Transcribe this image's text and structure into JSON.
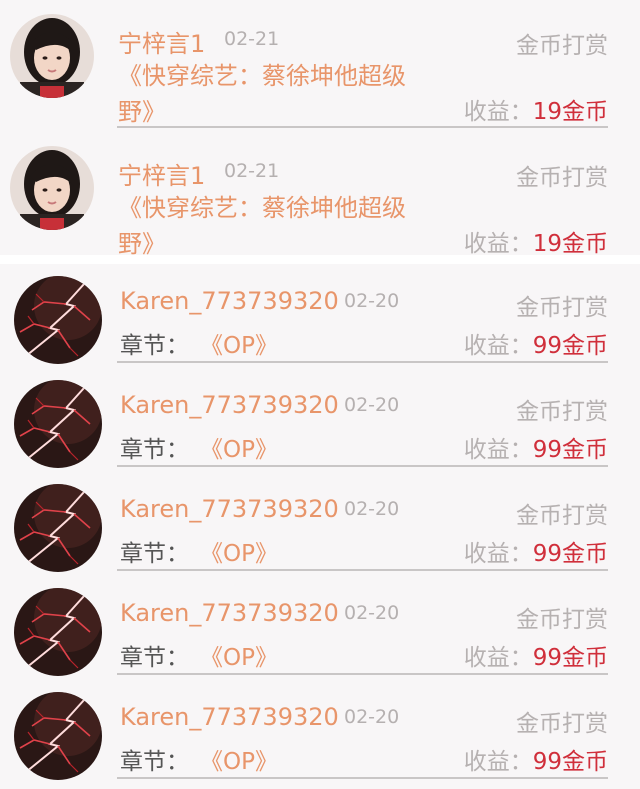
{
  "gift_rewards_top": [
    {
      "user_name": "宁梓言1",
      "date": "02-21",
      "reward_type": "金币打赏",
      "book_title": "《快穿综艺：蔡徐坤他超级野》",
      "earnings_label": "收益：",
      "earnings_amount": "19金币",
      "avatar_icon": "girl-photo-avatar"
    },
    {
      "user_name": "宁梓言1",
      "date": "02-21",
      "reward_type": "金币打赏",
      "book_title": "《快穿综艺：蔡徐坤他超级野》",
      "earnings_label": "收益：",
      "earnings_amount": "19金币",
      "avatar_icon": "girl-photo-avatar"
    }
  ],
  "gift_rewards_bottom": [
    {
      "user_name": "Karen_773739320",
      "date": "02-20",
      "reward_type": "金币打赏",
      "chapter_label": "章节：",
      "chapter_name": "《OP》",
      "earnings_label": "收益：",
      "earnings_amount": "99金币",
      "avatar_icon": "lightning-avatar"
    },
    {
      "user_name": "Karen_773739320",
      "date": "02-20",
      "reward_type": "金币打赏",
      "chapter_label": "章节：",
      "chapter_name": "《OP》",
      "earnings_label": "收益：",
      "earnings_amount": "99金币",
      "avatar_icon": "lightning-avatar"
    },
    {
      "user_name": "Karen_773739320",
      "date": "02-20",
      "reward_type": "金币打赏",
      "chapter_label": "章节：",
      "chapter_name": "《OP》",
      "earnings_label": "收益：",
      "earnings_amount": "99金币",
      "avatar_icon": "lightning-avatar"
    },
    {
      "user_name": "Karen_773739320",
      "date": "02-20",
      "reward_type": "金币打赏",
      "chapter_label": "章节：",
      "chapter_name": "《OP》",
      "earnings_label": "收益：",
      "earnings_amount": "99金币",
      "avatar_icon": "lightning-avatar"
    },
    {
      "user_name": "Karen_773739320",
      "date": "02-20",
      "reward_type": "金币打赏",
      "chapter_label": "章节：",
      "chapter_name": "《OP》",
      "earnings_label": "收益：",
      "earnings_amount": "99金币",
      "avatar_icon": "lightning-avatar"
    }
  ],
  "colors": {
    "name": "#e8956a",
    "amount": "#d02f3b",
    "muted": "#b6b1b1",
    "panel_bg": "#f8f6f7"
  }
}
